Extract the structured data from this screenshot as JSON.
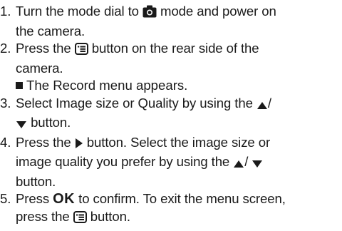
{
  "steps": [
    {
      "number": "1.",
      "line1_pre": "Turn the mode dial to ",
      "line1_icon": "camera-icon",
      "line1_post": " mode and power on",
      "line2": "the camera."
    },
    {
      "number": "2.",
      "line1_pre": "Press the ",
      "line1_icon": "menu-icon",
      "line1_post": " button on the rear side of the",
      "line2": "camera.",
      "note": "The Record menu appears."
    },
    {
      "number": "3.",
      "line1_pre": "Select Image size or Quality by using the ",
      "line1_icon": "up-triangle-icon",
      "line1_post": "/",
      "line2_icon": "down-triangle-icon",
      "line2_post": " button."
    },
    {
      "number": "4.",
      "line1_pre": "Press the ",
      "line1_icon": "right-triangle-icon",
      "line1_post": " button. Select the image size or",
      "line2_pre": "image quality you prefer by using the ",
      "line2_icon_a": "up-triangle-icon",
      "line2_mid": "/ ",
      "line2_icon_b": "down-triangle-icon",
      "line3": "button."
    },
    {
      "number": "5.",
      "line1_pre": "Press ",
      "line1_bold": "OK",
      "line1_post": " to confirm. To exit the menu screen,",
      "line2_pre": "press the ",
      "line2_icon": "menu-icon",
      "line2_post": " button."
    }
  ]
}
